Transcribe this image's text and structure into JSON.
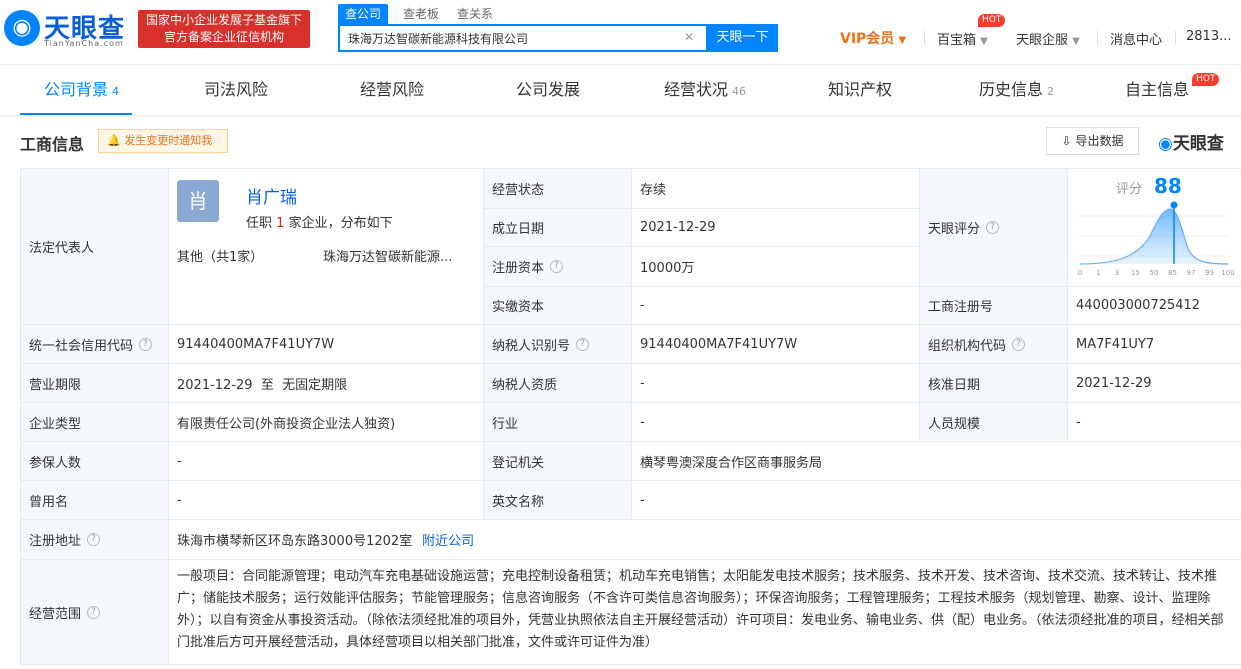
{
  "header": {
    "logo_text": "天眼查",
    "logo_sub": "TianYanCha.com",
    "gov_line1": "国家中小企业发展子基金旗下",
    "gov_line2": "官方备案企业征信机构",
    "search_tabs": [
      "查公司",
      "查老板",
      "查关系"
    ],
    "search_value": "珠海万达智碳新能源科技有限公司",
    "search_button": "天眼一下",
    "nav": {
      "vip": "VIP会员",
      "baobao": "百宝箱",
      "hot": "HOT",
      "enterprise": "天眼企服",
      "message": "消息中心",
      "user": "2813..."
    }
  },
  "tabs": [
    {
      "label": "公司背景",
      "count": "4"
    },
    {
      "label": "司法风险",
      "count": ""
    },
    {
      "label": "经营风险",
      "count": ""
    },
    {
      "label": "公司发展",
      "count": ""
    },
    {
      "label": "经营状况",
      "count": "46"
    },
    {
      "label": "知识产权",
      "count": ""
    },
    {
      "label": "历史信息",
      "count": "2"
    },
    {
      "label": "自主信息",
      "count": "",
      "hot": "HOT"
    }
  ],
  "section": {
    "title": "工商信息",
    "notify": "发生变更时通知我",
    "export": "导出数据",
    "brand": "天眼查"
  },
  "info": {
    "legal_label": "法定代表人",
    "avatar": "肖",
    "legal_name": "肖广瑞",
    "legal_pre": "任职",
    "legal_num": "1",
    "legal_post": "家企业，分布如下",
    "legal_other": "其他（共1家）",
    "legal_company": "珠海万达智碳新能源...",
    "status_label": "经营状态",
    "status": "存续",
    "founded_label": "成立日期",
    "founded": "2021-12-29",
    "capital_label": "注册资本",
    "capital": "10000万",
    "paid_label": "实缴资本",
    "paid": "-",
    "score_label": "天眼评分",
    "score_pre": "评分",
    "score": "88",
    "score_ticks": [
      "0",
      "1",
      "3",
      "15",
      "50",
      "85",
      "97",
      "99",
      "100"
    ],
    "reg_no_label": "工商注册号",
    "reg_no": "440003000725412",
    "credit_label": "统一社会信用代码",
    "credit": "91440400MA7F41UY7W",
    "tax_label": "纳税人识别号",
    "tax": "91440400MA7F41UY7W",
    "org_label": "组织机构代码",
    "org": "MA7F41UY7",
    "term_label": "营业期限",
    "term": "2021-12-29  至  无固定期限",
    "tax_qual_label": "纳税人资质",
    "tax_qual": "-",
    "approve_label": "核准日期",
    "approve": "2021-12-29",
    "type_label": "企业类型",
    "type": "有限责任公司(外商投资企业法人独资)",
    "industry_label": "行业",
    "industry": "-",
    "staff_label": "人员规模",
    "staff": "-",
    "insured_label": "参保人数",
    "insured": "-",
    "authority_label": "登记机关",
    "authority": "横琴粤澳深度合作区商事服务局",
    "former_label": "曾用名",
    "former": "-",
    "english_label": "英文名称",
    "english": "-",
    "address_label": "注册地址",
    "address": "珠海市横琴新区环岛东路3000号1202室",
    "nearby": "附近公司",
    "scope_label": "经营范围",
    "scope": "一般项目：合同能源管理；电动汽车充电基础设施运营；充电控制设备租赁；机动车充电销售；太阳能发电技术服务；技术服务、技术开发、技术咨询、技术交流、技术转让、技术推广；储能技术服务；运行效能评估服务；节能管理服务；信息咨询服务（不含许可类信息咨询服务）；环保咨询服务；工程管理服务；工程技术服务（规划管理、勘察、设计、监理除外）；以自有资金从事投资活动。（除依法须经批准的项目外，凭营业执照依法自主开展经营活动）许可项目：发电业务、输电业务、供（配）电业务。（依法须经批准的项目，经相关部门批准后方可开展经营活动，具体经营项目以相关部门批准，文件或许可证件为准）"
  },
  "colors": {
    "accent": "#0084ff",
    "gov_red": "#d9302c",
    "vip": "#e8721c"
  }
}
